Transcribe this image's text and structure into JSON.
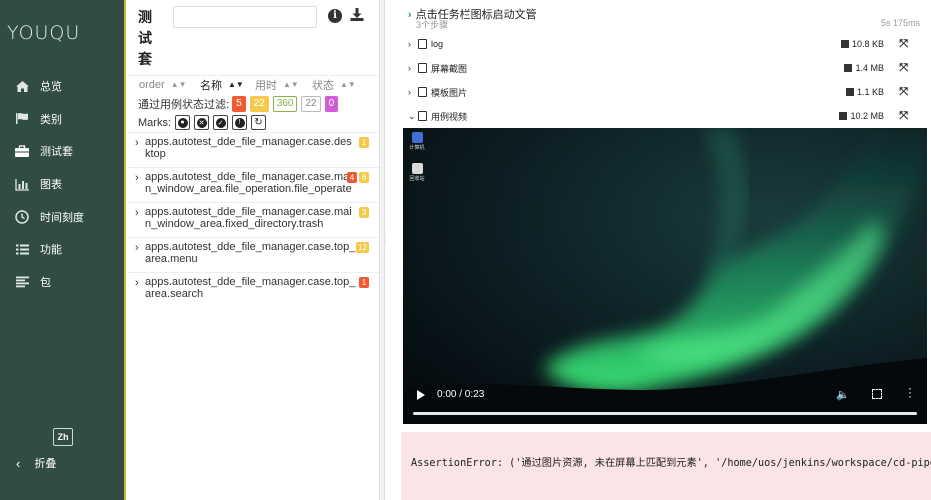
{
  "sidebar": {
    "logo": "YOUQU",
    "items": [
      {
        "icon": "home-icon",
        "label": "总览"
      },
      {
        "icon": "flag-icon",
        "label": "类别"
      },
      {
        "icon": "briefcase-icon",
        "label": "测试套"
      },
      {
        "icon": "bar-chart-icon",
        "label": "图表"
      },
      {
        "icon": "clock-icon",
        "label": "时间刻度"
      },
      {
        "icon": "list-icon",
        "label": "功能"
      },
      {
        "icon": "align-left-icon",
        "label": "包"
      }
    ],
    "lang_label": "Zh",
    "collapse_label": "折叠"
  },
  "suites": {
    "title": "测试套",
    "search_placeholder": "",
    "sort": {
      "order": "order",
      "name": "名称",
      "duration": "用时",
      "status": "状态"
    },
    "filter_label": "通过用例状态过滤:",
    "filter_badges": [
      {
        "value": "5",
        "color": "#f05a30",
        "text_color": "#fff",
        "border": "#f05a30"
      },
      {
        "value": "22",
        "color": "#f5c94a",
        "text_color": "#fff",
        "border": "#f5c94a"
      },
      {
        "value": "360",
        "color": "#fff",
        "text_color": "#8ab34a",
        "border": "#8ab34a"
      },
      {
        "value": "22",
        "color": "#fff",
        "text_color": "#888",
        "border": "#bbb"
      },
      {
        "value": "0",
        "color": "#d05cd6",
        "text_color": "#fff",
        "border": "#d05cd6"
      }
    ],
    "marks_label": "Marks:",
    "cases": [
      {
        "name": "apps.autotest_dde_file_manager.case.desktop",
        "counts": [
          {
            "v": "1",
            "c": "#f5c94a"
          }
        ]
      },
      {
        "name": "apps.autotest_dde_file_manager.case.main_window_area.file_operation.file_operate",
        "counts": [
          {
            "v": "4",
            "c": "#f05a30"
          },
          {
            "v": "6",
            "c": "#f5c94a"
          }
        ]
      },
      {
        "name": "apps.autotest_dde_file_manager.case.main_window_area.fixed_directory.trash",
        "counts": [
          {
            "v": "3",
            "c": "#f5c94a"
          }
        ]
      },
      {
        "name": "apps.autotest_dde_file_manager.case.top_area.menu",
        "counts": [
          {
            "v": "12",
            "c": "#f5c94a"
          }
        ]
      },
      {
        "name": "apps.autotest_dde_file_manager.case.top_area.search",
        "counts": [
          {
            "v": "1",
            "c": "#f05a30"
          }
        ]
      }
    ]
  },
  "detail": {
    "step_title": "点击任务栏图标启动文管",
    "step_sub": "3个步骤",
    "duration": "5s 175ms",
    "attachments": [
      {
        "name": "log",
        "size": "10.8 KB",
        "expanded": false
      },
      {
        "name": "屏幕截图",
        "size": "1.4 MB",
        "expanded": false
      },
      {
        "name": "模板图片",
        "size": "1.1 KB",
        "expanded": false
      },
      {
        "name": "用例视频",
        "size": "10.2 MB",
        "expanded": true
      }
    ],
    "video": {
      "time": "0:00 / 0:23",
      "desktop_icons": [
        {
          "label": "计算机",
          "color": "#3f6fd6"
        },
        {
          "label": "回收站",
          "color": "#d9d9d9"
        }
      ]
    },
    "error_text": "AssertionError: ('通过图片资源, 未在屏幕上匹配到元素', '/home/uos/jenkins/workspace/cd-pipeli"
  }
}
